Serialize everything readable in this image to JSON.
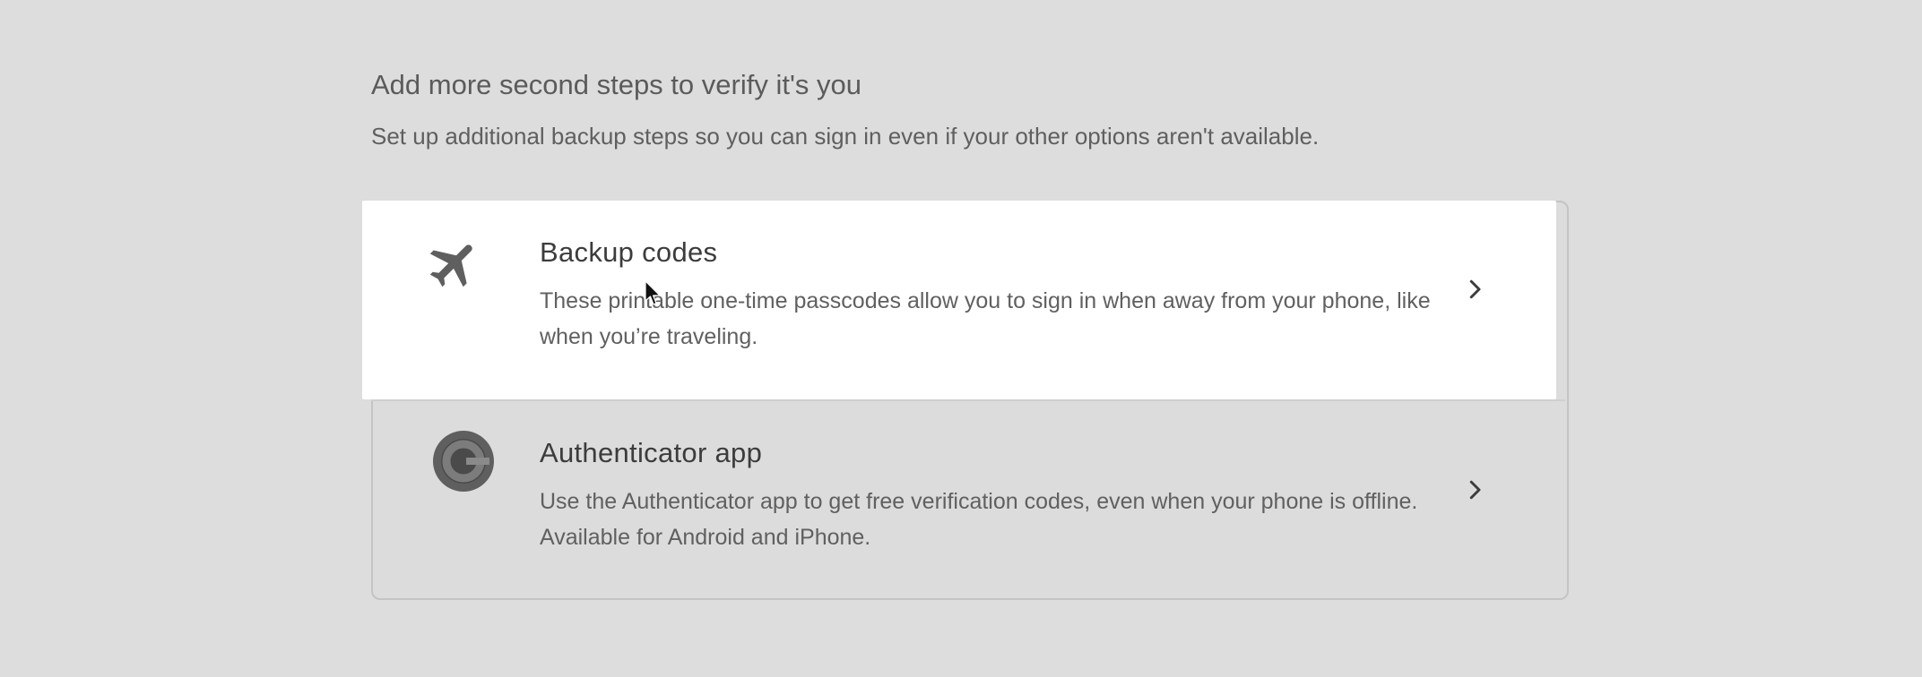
{
  "section": {
    "title": "Add more second steps to verify it's you",
    "description": "Set up additional backup steps so you can sign in even if your other options aren't available."
  },
  "options": [
    {
      "title": "Backup codes",
      "description": "These printable one-time passcodes allow you to sign in when away from your phone, like when you’re traveling.",
      "icon": "airplane-icon",
      "highlighted": true
    },
    {
      "title": "Authenticator app",
      "description": "Use the Authenticator app to get free verification codes, even when your phone is offline. Available for Android and iPhone.",
      "icon": "authenticator-icon",
      "highlighted": false
    }
  ],
  "colors": {
    "background": "#dddddd",
    "highlight": "#ffffff",
    "icon": "#5f5f5f"
  }
}
